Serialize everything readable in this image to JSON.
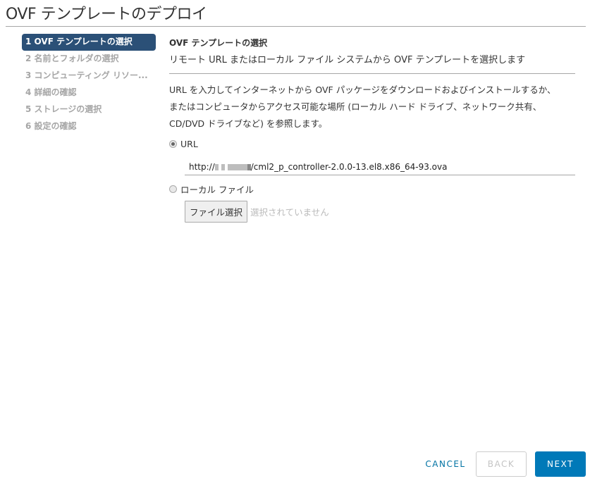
{
  "window": {
    "title": "OVF テンプレートのデプロイ"
  },
  "steps": [
    {
      "label": "1 OVF テンプレートの選択",
      "active": true
    },
    {
      "label": "2 名前とフォルダの選択",
      "active": false
    },
    {
      "label": "3 コンピューティング リソー...",
      "active": false
    },
    {
      "label": "4 詳細の確認",
      "active": false
    },
    {
      "label": "5 ストレージの選択",
      "active": false
    },
    {
      "label": "6 設定の確認",
      "active": false
    }
  ],
  "section": {
    "title": "OVF テンプレートの選択",
    "subtitle": "リモート URL またはローカル ファイル システムから OVF テンプレートを選択します",
    "description_lines": [
      "URL を入力してインターネットから OVF パッケージをダウンロードおよびインストールするか、",
      "またはコンピュータからアクセス可能な場所 (ローカル ハード ドライブ、ネットワーク共有、",
      "CD/DVD ドライブなど) を参照します。"
    ]
  },
  "source_options": {
    "url_label": "URL",
    "url_selected": true,
    "url_prefix": "http://",
    "url_suffix": "/cml2_p_controller-2.0.0-13.el8.x86_64-93.ova",
    "local_label": "ローカル ファイル",
    "local_selected": false,
    "file_button_label": "ファイル選択",
    "file_status": "選択されていません"
  },
  "footer": {
    "cancel_label": "CANCEL",
    "back_label": "BACK",
    "next_label": "NEXT"
  }
}
